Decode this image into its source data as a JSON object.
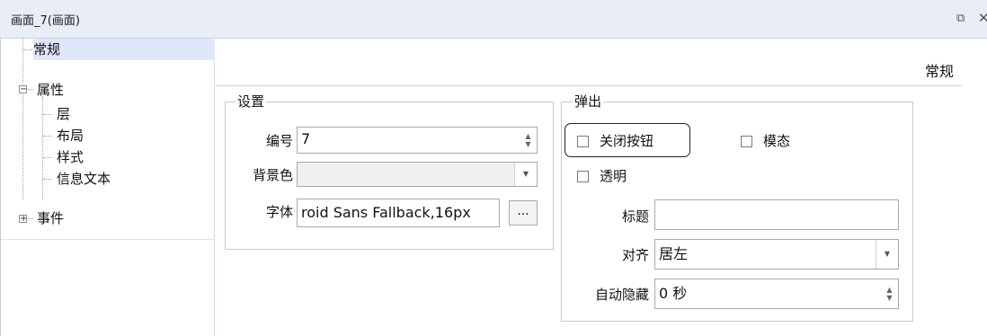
{
  "window": {
    "title": "画面_7(画面)",
    "restore_icon": "restore-icon",
    "close_icon": "close-icon"
  },
  "tree": {
    "items": [
      {
        "label": "常规",
        "selected": true
      },
      {
        "label": "属性",
        "expander": "minus"
      },
      {
        "label": "层"
      },
      {
        "label": "布局"
      },
      {
        "label": "样式"
      },
      {
        "label": "信息文本"
      },
      {
        "label": "事件",
        "expander": "plus"
      }
    ]
  },
  "section_heading": "常规",
  "settings": {
    "legend": "设置",
    "number_label": "编号",
    "number_value": "7",
    "bgcolor_label": "背景色",
    "bgcolor_value": "",
    "font_label": "字体",
    "font_value": "roid Sans Fallback,16px",
    "font_button": "..."
  },
  "popup": {
    "legend": "弹出",
    "close_button_label": "关闭按钮",
    "modal_label": "模态",
    "transparent_label": "透明",
    "title_label": "标题",
    "title_value": "",
    "align_label": "对齐",
    "align_value": "居左",
    "autohide_label": "自动隐藏",
    "autohide_value": "0 秒"
  }
}
